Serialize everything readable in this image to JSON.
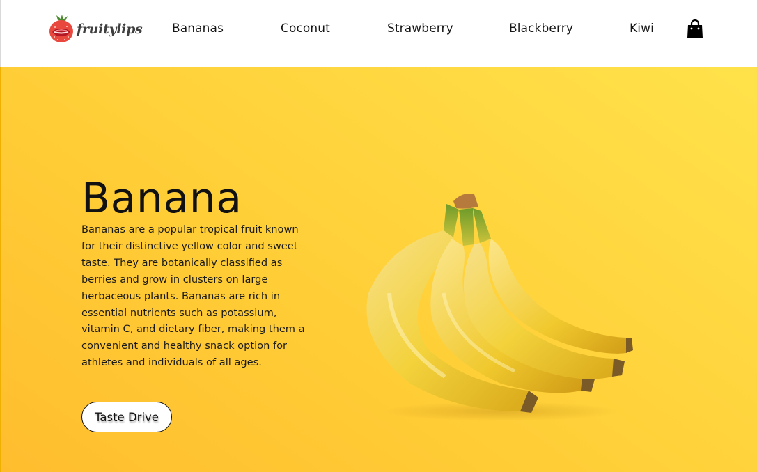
{
  "brand": {
    "name": "fruitylips"
  },
  "nav": {
    "items": [
      {
        "label": "Bananas"
      },
      {
        "label": "Coconut"
      },
      {
        "label": "Strawberry"
      },
      {
        "label": "Blackberry"
      },
      {
        "label": "Kiwi"
      }
    ],
    "cart_icon": "shopping-bag-icon"
  },
  "hero": {
    "title": "Banana",
    "description": "Bananas are a popular tropical fruit known for their distinctive yellow color and sweet taste. They are botanically classified as berries and grow in clusters on large herbaceous plants. Bananas are rich in essential nutrients such as potassium, vitamin C, and dietary fiber, making them a convenient and healthy snack option for athletes and individuals of all ages.",
    "button_label": "Taste Drive",
    "image": "banana-bunch-image"
  },
  "colors": {
    "hero_start": "#ffbd2e",
    "hero_end": "#ffe24b",
    "text": "#111111",
    "header_bg": "#ffffff"
  }
}
